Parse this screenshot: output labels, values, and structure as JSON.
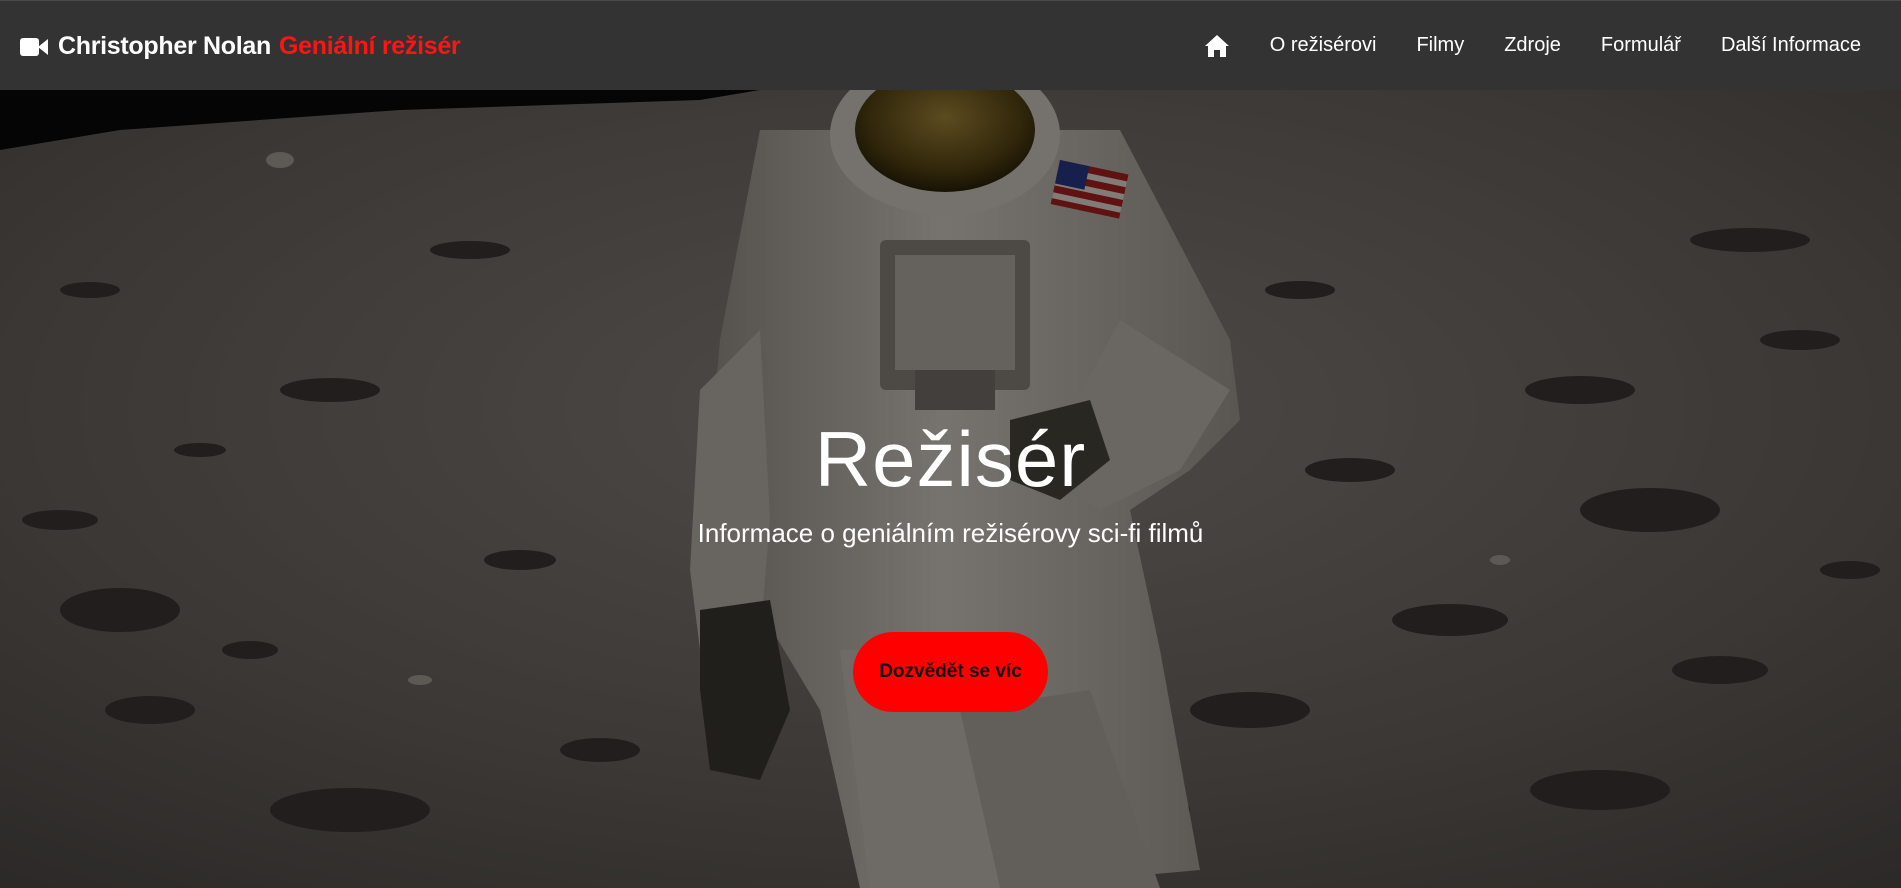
{
  "navbar": {
    "brand_name": "Christopher Nolan",
    "brand_accent": "Geniální režisér",
    "brand_icon": "video-camera-icon",
    "home_icon": "home-icon",
    "links": [
      "O režisérovi",
      "Filmy",
      "Zdroje",
      "Formulář",
      "Další Informace"
    ]
  },
  "hero": {
    "background_image": "astronaut-on-moon-photo",
    "title": "Režisér",
    "subtitle": "Informace o geniálním režisérovy sci-fi filmů",
    "cta_label": "Dozvědět se víc"
  },
  "colors": {
    "navbar_bg": "#333333",
    "accent": "#ff1414",
    "cta_bg": "#ff0000",
    "text": "#ffffff"
  }
}
